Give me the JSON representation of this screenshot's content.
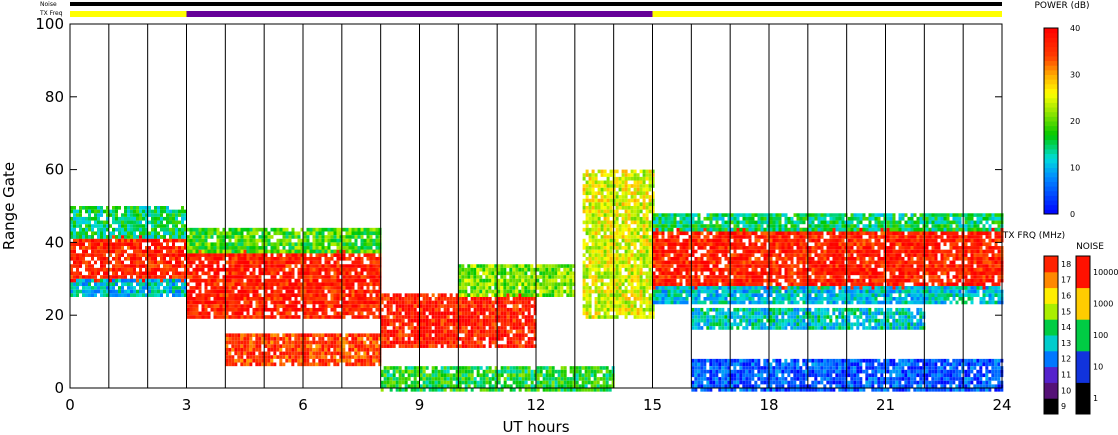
{
  "header": {
    "noise_label": "Noise",
    "txfreq_label": "TX Freq"
  },
  "chart_data": {
    "type": "heatmap",
    "xlabel": "UT hours",
    "ylabel": "Range Gate",
    "xlim": [
      0,
      24
    ],
    "ylim": [
      0,
      100
    ],
    "xticks": [
      "0",
      "3",
      "6",
      "9",
      "12",
      "15",
      "18",
      "21",
      "24"
    ],
    "yticks": [
      "0",
      "20",
      "40",
      "60",
      "80",
      "100"
    ],
    "grid_vertical_hours": [
      1,
      2,
      3,
      4,
      5,
      6,
      7,
      8,
      9,
      10,
      11,
      12,
      13,
      14,
      15,
      16,
      17,
      18,
      19,
      20,
      21,
      22,
      23
    ],
    "tx_freq_bar": [
      {
        "start": 0,
        "end": 3,
        "color": "#ffff00"
      },
      {
        "start": 3,
        "end": 15,
        "color": "#660099"
      },
      {
        "start": 15,
        "end": 24,
        "color": "#ffff00"
      }
    ],
    "backscatter_bands": [
      {
        "x0": 0,
        "x1": 3,
        "y0": 30,
        "y1": 42,
        "power": 40
      },
      {
        "x0": 0,
        "x1": 3,
        "y0": 42,
        "y1": 50,
        "power": 18
      },
      {
        "x0": 0,
        "x1": 3,
        "y0": 26,
        "y1": 30,
        "power": 14
      },
      {
        "x0": 3,
        "x1": 8,
        "y0": 20,
        "y1": 38,
        "power": 40
      },
      {
        "x0": 3,
        "x1": 8,
        "y0": 38,
        "y1": 44,
        "power": 22
      },
      {
        "x0": 4,
        "x1": 8,
        "y0": 7,
        "y1": 15,
        "power": 38
      },
      {
        "x0": 8,
        "x1": 12,
        "y0": 12,
        "y1": 26,
        "power": 40
      },
      {
        "x0": 10,
        "x1": 13,
        "y0": 26,
        "y1": 34,
        "power": 24
      },
      {
        "x0": 8,
        "x1": 14,
        "y0": 0,
        "y1": 6,
        "power": 20
      },
      {
        "x0": 13.2,
        "x1": 15,
        "y0": 20,
        "y1": 60,
        "power": 28
      },
      {
        "x0": 15,
        "x1": 24,
        "y0": 28,
        "y1": 44,
        "power": 40
      },
      {
        "x0": 15,
        "x1": 24,
        "y0": 44,
        "y1": 48,
        "power": 18
      },
      {
        "x0": 15,
        "x1": 24,
        "y0": 24,
        "y1": 28,
        "power": 14
      },
      {
        "x0": 16,
        "x1": 22,
        "y0": 17,
        "y1": 22,
        "power": 15
      },
      {
        "x0": 16,
        "x1": 24,
        "y0": 0,
        "y1": 8,
        "power": 8
      }
    ],
    "power_scale": {
      "title": "POWER (dB)",
      "min": 0,
      "max": 40,
      "ticks": [
        "0",
        "10",
        "20",
        "30",
        "40"
      ]
    },
    "txfreq_scale": {
      "title": "TX FRQ (MHz)",
      "min": 9,
      "max": 18,
      "ticks": [
        "9",
        "10",
        "11",
        "12",
        "13",
        "14",
        "15",
        "16",
        "17",
        "18"
      ]
    },
    "noise_scale": {
      "title": "NOISE",
      "ticks": [
        "1",
        "10",
        "100",
        "1000",
        "10000"
      ]
    },
    "colors": {
      "axis": "#000000",
      "background": "#ffffff",
      "scatter_red": "#ff0000",
      "scatter_blue": "#0033ff"
    }
  }
}
